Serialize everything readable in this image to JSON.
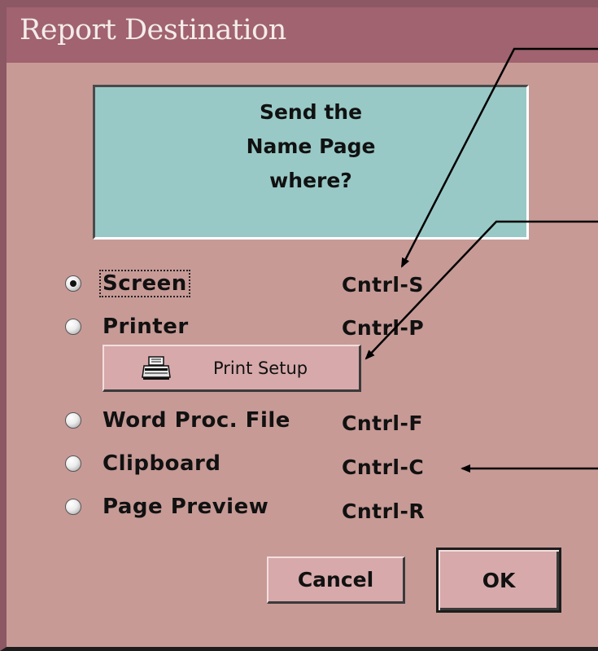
{
  "dialog": {
    "title": "Report Destination",
    "prompt": "Send the\nName Page\nwhere?"
  },
  "options": [
    {
      "label": "Screen",
      "shortcut": "Cntrl-S",
      "selected": true,
      "focused": true
    },
    {
      "label": "Printer",
      "shortcut": "Cntrl-P",
      "selected": false
    },
    {
      "label": "Word Proc. File",
      "shortcut": "Cntrl-F",
      "selected": false
    },
    {
      "label": "Clipboard",
      "shortcut": "Cntrl-C",
      "selected": false
    },
    {
      "label": "Page Preview",
      "shortcut": "Cntrl-R",
      "selected": false
    }
  ],
  "print_setup": {
    "label": "Print Setup",
    "icon": "printer-icon"
  },
  "buttons": {
    "cancel": "Cancel",
    "ok": "OK"
  },
  "colors": {
    "background": "#c79a96",
    "titlebar": "#a0636f",
    "prompt_box": "#98c9c6",
    "button": "#d7a9ab"
  }
}
